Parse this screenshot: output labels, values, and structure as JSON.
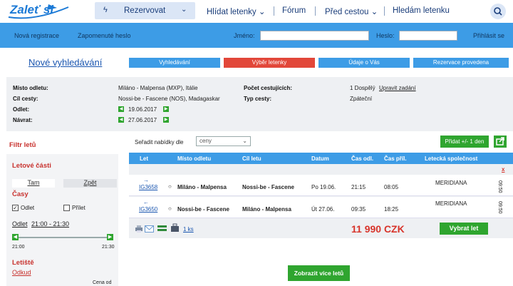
{
  "brand": {
    "logo_text": "Zaleť si"
  },
  "nav": {
    "reserve": "Rezervovat",
    "watch": "Hlídat letenky",
    "forum": "Fórum",
    "before": "Před cestou",
    "searching": "Hledám letenku"
  },
  "login": {
    "register": "Nová registrace",
    "forgot": "Zapomenuté heslo",
    "name_label": "Jméno:",
    "password_label": "Heslo:",
    "submit": "Přihlásit se"
  },
  "steps": {
    "new_search": "Nové vyhledávání",
    "items": [
      "Vyhledávání",
      "Výběr letenky",
      "Údaje o Vás",
      "Rezervace provedena"
    ]
  },
  "summary": {
    "from_label": "Místo odletu:",
    "from_value": "Miláno - Malpensa (MXP), Itálie",
    "to_label": "Cíl cesty:",
    "to_value": "Nossi-be - Fascene (NOS), Madagaskar",
    "dep_label": "Odlet:",
    "dep_value": "19.06.2017",
    "ret_label": "Návrat:",
    "ret_value": "27.06.2017",
    "pax_label": "Počet cestujících:",
    "pax_value": "1 Dospělý",
    "edit_link": "Upravit zadání",
    "type_label": "Typ cesty:",
    "type_value": "Zpáteční"
  },
  "sidebar": {
    "title": "Filtr letů",
    "segments": "Letové části",
    "tab_there": "Tam",
    "tab_back": "Zpět",
    "times": "Časy",
    "departure": "Odlet",
    "arrival": "Přílet",
    "range_label": "Odlet",
    "range_value": "21:00 - 21:30",
    "slider_min": "21:00",
    "slider_max": "21:30",
    "airports": "Letiště",
    "origin": "Odkud",
    "price_from": "Cena od"
  },
  "results": {
    "sort_label": "Seřadit nabídky dle",
    "sort_value": "ceny",
    "add_day": "Přidat +/- 1 den",
    "headers": [
      "Let",
      "Místo odletu",
      "Cíl letu",
      "Datum",
      "Čas odl.",
      "Čas příl.",
      "Letecká společnost"
    ],
    "close": "x",
    "flights": [
      {
        "code": "IG3658",
        "arrow": "→",
        "from": "Miláno - Malpensa",
        "to": "Nossi-be - Fascene",
        "date": "Po 19.06.",
        "dep": "21:15",
        "arr": "08:05",
        "airline": "MERIDIANA",
        "duration": "09:50"
      },
      {
        "code": "IG3650",
        "arrow": "←",
        "from": "Nossi-be - Fascene",
        "to": "Miláno - Malpensa",
        "date": "Út 27.06.",
        "dep": "09:35",
        "arr": "18:25",
        "airline": "MERIDIANA",
        "duration": "09:50"
      }
    ],
    "bags": "1 ks",
    "price": "11 990 CZK",
    "select": "Vybrat let",
    "more": "Zobrazit více letů"
  }
}
